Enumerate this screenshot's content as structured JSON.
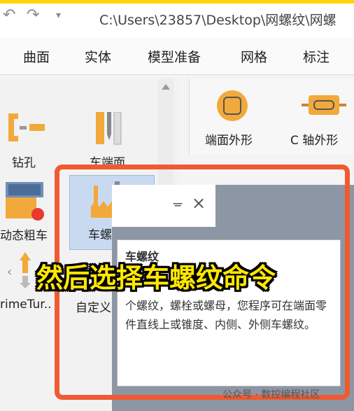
{
  "window": {
    "title": "C:\\Users\\23857\\Desktop\\网螺纹\\网螺"
  },
  "qat": {
    "undo_icon": "undo-icon",
    "redo_icon": "redo-icon",
    "more_icon": "dropdown-icon"
  },
  "menu": {
    "items": [
      "曲面",
      "实体",
      "模型准备",
      "网格",
      "标注"
    ]
  },
  "ribbon_left": {
    "drill_label": "钻孔",
    "face_turn_label": "车端面",
    "rough_label": "动态粗车",
    "thread_label": "车螺纹",
    "primeturning_label": "rimeTur..",
    "custom_label": "自定义"
  },
  "ribbon_right": {
    "end_profile_label": "端面外形",
    "c_axis_label": "C 轴外形"
  },
  "dialog": {
    "pin": "ᚚ",
    "close": "×"
  },
  "tooltip": {
    "title": "车螺纹",
    "body": "个螺纹，螺栓或螺母，您程序可在端面零件直线上或锥度、内侧、外侧车螺纹。"
  },
  "caption": "然后选择车螺纹命令",
  "watermark": "公众号 · 数控编程社区",
  "colors": {
    "highlight": "#f05a30",
    "caption": "#ffe800",
    "accent": "#ffd400",
    "icon_orange": "#f2a93b"
  }
}
